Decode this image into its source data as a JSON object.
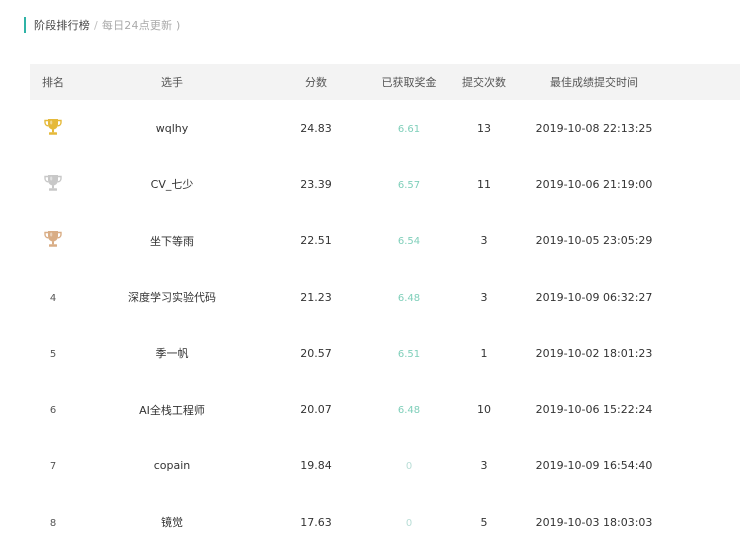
{
  "header": {
    "title": "阶段排行榜",
    "separator": "/",
    "subtitle": "每日24点更新 )"
  },
  "table": {
    "columns": [
      "排名",
      "选手",
      "分数",
      "已获取奖金",
      "提交次数",
      "最佳成绩提交时间"
    ],
    "rows": [
      {
        "rank": "1",
        "rank_icon": "trophy-gold-icon",
        "player": "wqlhy",
        "score": "24.83",
        "prize": "6.61",
        "submissions": "13",
        "best_time": "2019-10-08 22:13:25"
      },
      {
        "rank": "2",
        "rank_icon": "trophy-silver-icon",
        "player": "CV_七少",
        "score": "23.39",
        "prize": "6.57",
        "submissions": "11",
        "best_time": "2019-10-06 21:19:00"
      },
      {
        "rank": "3",
        "rank_icon": "trophy-bronze-icon",
        "player": "坐下等雨",
        "score": "22.51",
        "prize": "6.54",
        "submissions": "3",
        "best_time": "2019-10-05 23:05:29"
      },
      {
        "rank": "4",
        "rank_icon": "",
        "player": "深度学习实验代码",
        "score": "21.23",
        "prize": "6.48",
        "submissions": "3",
        "best_time": "2019-10-09 06:32:27"
      },
      {
        "rank": "5",
        "rank_icon": "",
        "player": "季一帆",
        "score": "20.57",
        "prize": "6.51",
        "submissions": "1",
        "best_time": "2019-10-02 18:01:23"
      },
      {
        "rank": "6",
        "rank_icon": "",
        "player": "AI全栈工程师",
        "score": "20.07",
        "prize": "6.48",
        "submissions": "10",
        "best_time": "2019-10-06 15:22:24"
      },
      {
        "rank": "7",
        "rank_icon": "",
        "player": "copain",
        "score": "19.84",
        "prize": "0",
        "submissions": "3",
        "best_time": "2019-10-09 16:54:40"
      },
      {
        "rank": "8",
        "rank_icon": "",
        "player": "镜觉",
        "score": "17.63",
        "prize": "0",
        "submissions": "5",
        "best_time": "2019-10-03 18:03:03"
      }
    ]
  },
  "colors": {
    "accent": "#2fb3a6",
    "prize": "#7fcfba",
    "gold": "#e5b93a",
    "silver": "#c8c8c8",
    "bronze": "#d9ad85",
    "header_bg": "#f3f3f3"
  }
}
